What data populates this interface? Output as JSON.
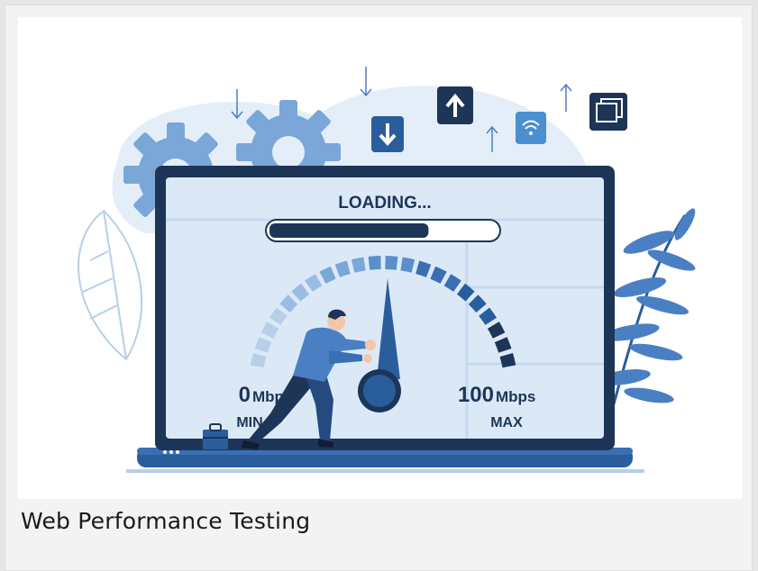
{
  "card": {
    "caption": "Web Performance Testing"
  },
  "screen": {
    "loading_label": "LOADING...",
    "progress": 0.7,
    "gauge_min_value": "0",
    "gauge_min_unit": "Mbps",
    "gauge_min_label": "MIN",
    "gauge_max_value": "100",
    "gauge_max_unit": "Mbps",
    "gauge_max_label": "MAX"
  },
  "icons": [
    "gear-icon",
    "download-icon",
    "upload-icon",
    "wifi-icon",
    "window-icon",
    "briefcase-icon"
  ],
  "colors": {
    "navy": "#1d3557",
    "accent": "#2a5d9c",
    "light_blue": "#7aa6d8",
    "screen_bg": "#dbe9f7",
    "card_bg": "#f3f3f3"
  }
}
